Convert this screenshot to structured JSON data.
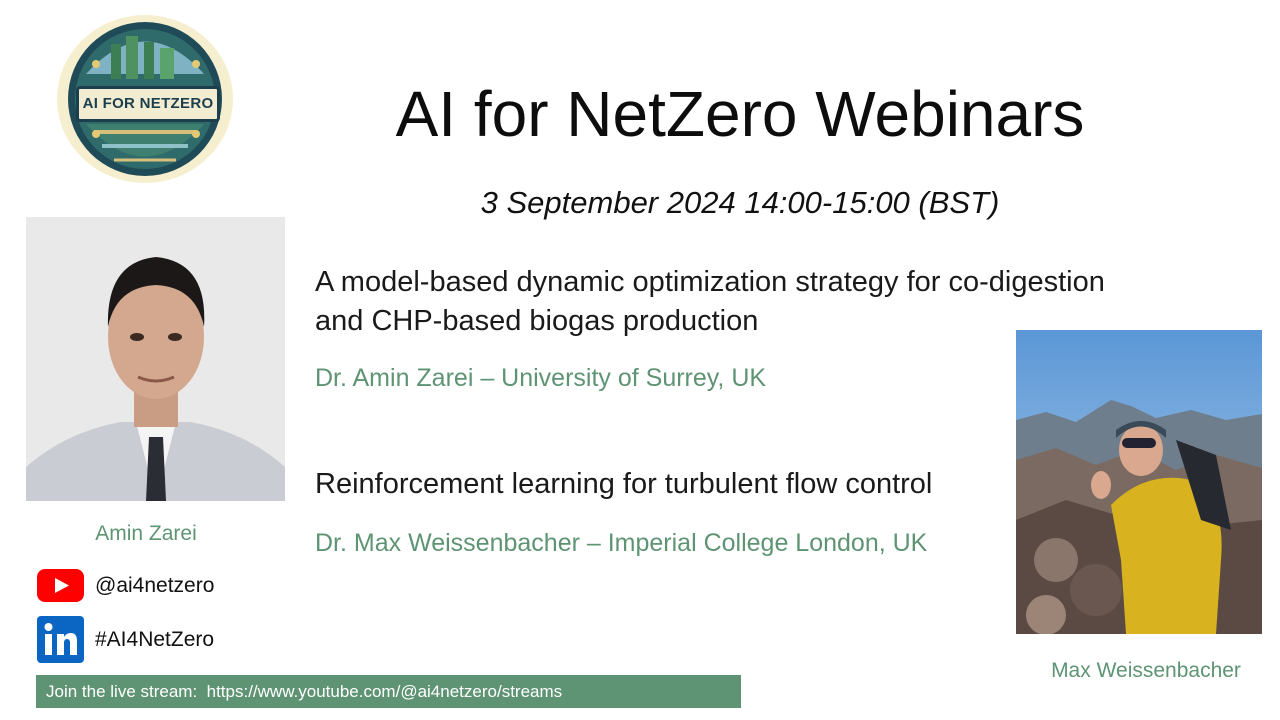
{
  "logo": {
    "text": "AI FOR NETZERO"
  },
  "header": {
    "title": "AI for NetZero Webinars",
    "date": "3 September 2024 14:00-15:00 (BST)"
  },
  "talks": [
    {
      "title_line1": "A model-based dynamic optimization strategy for co-digestion",
      "title_line2": "and CHP-based biogas production",
      "speaker": "Dr. Amin Zarei – University of Surrey, UK"
    },
    {
      "title_line1": "Reinforcement learning for turbulent flow control",
      "speaker": "Dr. Max Weissenbacher – Imperial College London, UK"
    }
  ],
  "captions": {
    "amin": "Amin Zarei",
    "max": "Max Weissenbacher"
  },
  "social": {
    "youtube_icon": "youtube-icon",
    "youtube_handle": "@ai4netzero",
    "linkedin_icon": "linkedin-icon",
    "linkedin_tag": "#AI4NetZero"
  },
  "stream": {
    "text": "Join the live stream:  https://www.youtube.com/@ai4netzero/streams"
  },
  "colors": {
    "accent_green": "#5e9473",
    "youtube_red": "#ff0000",
    "linkedin_blue": "#0a66c2"
  }
}
